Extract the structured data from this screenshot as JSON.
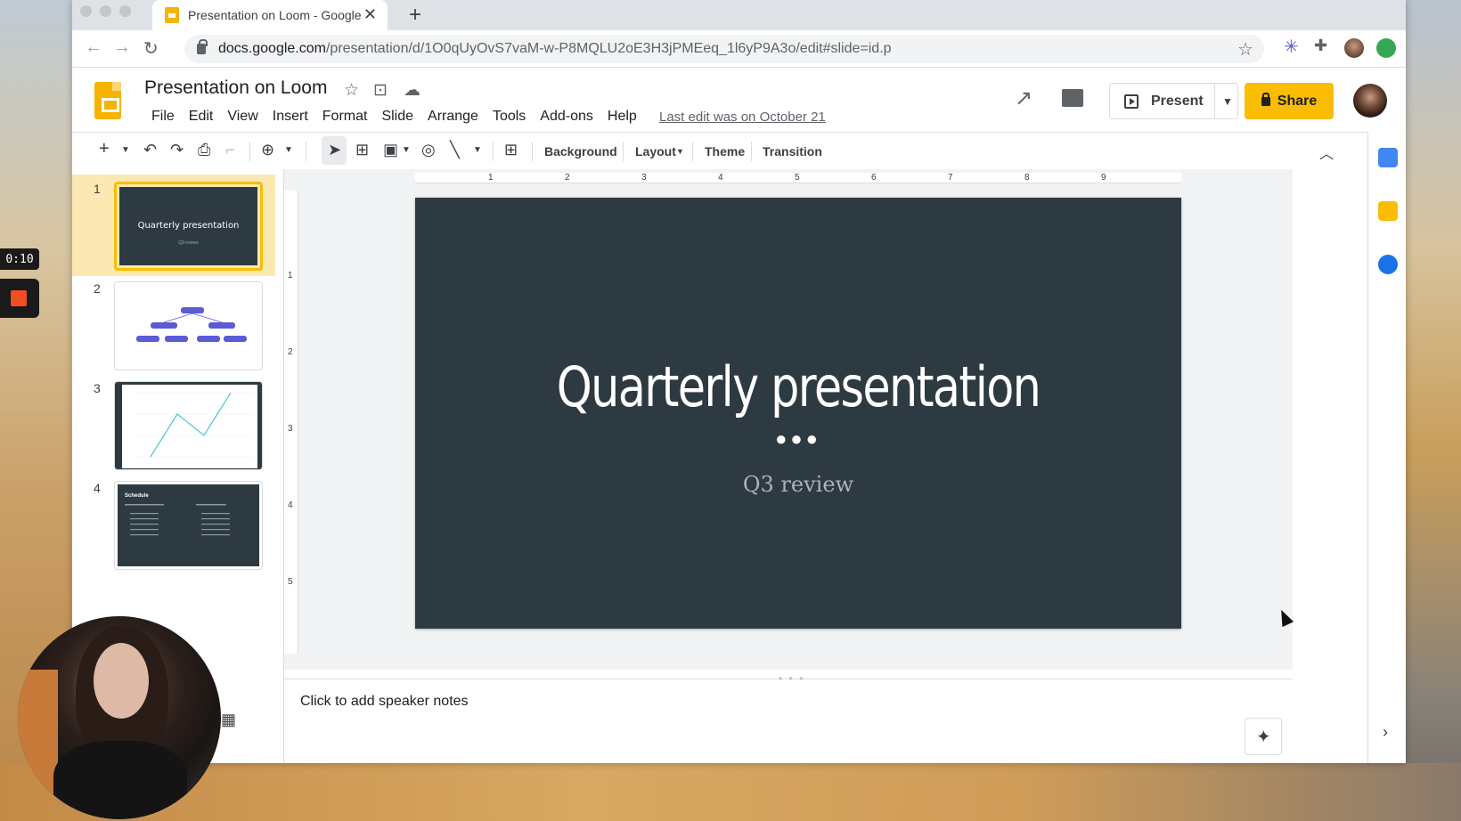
{
  "browser": {
    "tab_title": "Presentation on Loom - Google",
    "tab_close": "✕",
    "new_tab": "+",
    "url_host": "docs.google.com",
    "url_path": "/presentation/d/1O0qUyOvS7vaM-w-P8MQLU2oE3H3jPMEeq_1l6yP9A3o/edit#slide=id.p"
  },
  "docs": {
    "title": "Presentation on Loom",
    "menu": [
      "File",
      "Edit",
      "View",
      "Insert",
      "Format",
      "Slide",
      "Arrange",
      "Tools",
      "Add-ons",
      "Help"
    ],
    "last_edit": "Last edit was on October 21",
    "present_label": "Present",
    "share_label": "Share"
  },
  "toolbar": {
    "background": "Background",
    "layout": "Layout",
    "theme": "Theme",
    "transition": "Transition"
  },
  "filmstrip": {
    "numbers": [
      "1",
      "2",
      "3",
      "4"
    ],
    "thumb1_title": "Quarterly presentation",
    "thumb1_sub": "Q3 review",
    "thumb4_title": "Schedule"
  },
  "ruler": {
    "h_ticks": [
      "1",
      "2",
      "3",
      "4",
      "5",
      "6",
      "7",
      "8",
      "9"
    ],
    "v_ticks": [
      "1",
      "2",
      "3",
      "4",
      "5"
    ]
  },
  "slide": {
    "title": "Quarterly presentation",
    "dots": "●●●",
    "subtitle": "Q3 review"
  },
  "notes": {
    "placeholder": "Click to add speaker notes"
  },
  "loom": {
    "timer": "0:10"
  },
  "colors": {
    "accent": "#fbbc04",
    "slide_bg": "#2e3a41"
  }
}
